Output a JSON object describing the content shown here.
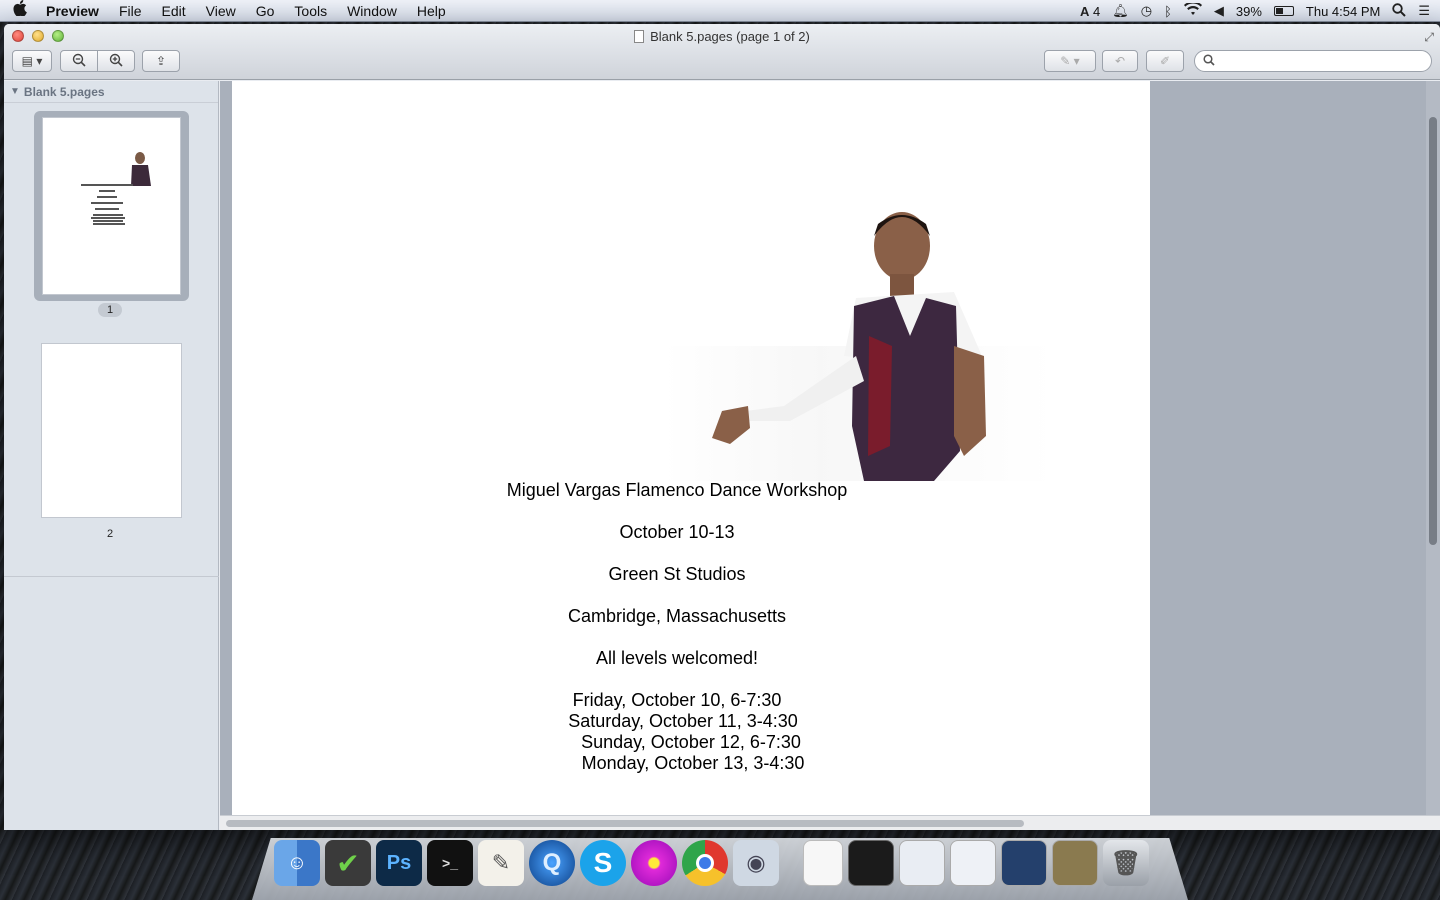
{
  "menubar": {
    "app_name": "Preview",
    "menus": [
      "File",
      "Edit",
      "View",
      "Go",
      "Tools",
      "Window",
      "Help"
    ],
    "status": {
      "adobe_count": "4",
      "battery": "39%",
      "clock": "Thu 4:54 PM"
    }
  },
  "window": {
    "title": "Blank 5.pages (page 1 of 2)",
    "search_placeholder": ""
  },
  "sidebar": {
    "doc_name": "Blank 5.pages",
    "thumbnails": [
      {
        "label": "1",
        "selected": true
      },
      {
        "label": "2",
        "selected": false
      }
    ]
  },
  "document": {
    "lines": [
      "Miguel Vargas Flamenco Dance Workshop",
      "October 10-13",
      "Green St Studios",
      "Cambridge, Massachusetts",
      "All levels welcomed!"
    ],
    "schedule": [
      "Friday, October 10, 6-7:30",
      "Saturday, October 11, 3-4:30",
      "Sunday, October 12, 6-7:30",
      "Monday, October 13, 3-4:30"
    ]
  },
  "dock": {
    "items": [
      "finder-icon",
      "app-checkmark-icon",
      "photoshop-icon",
      "terminal-icon",
      "textedit-icon",
      "quicktime-icon",
      "skype-icon",
      "flower-app-icon",
      "chrome-icon",
      "preview-app-icon",
      "documents-stack-icon",
      "terminal-window-icon",
      "chrome-window-icon",
      "chrome-window-icon",
      "chrome-window-icon",
      "chrome-window-icon",
      "trash-icon"
    ]
  }
}
